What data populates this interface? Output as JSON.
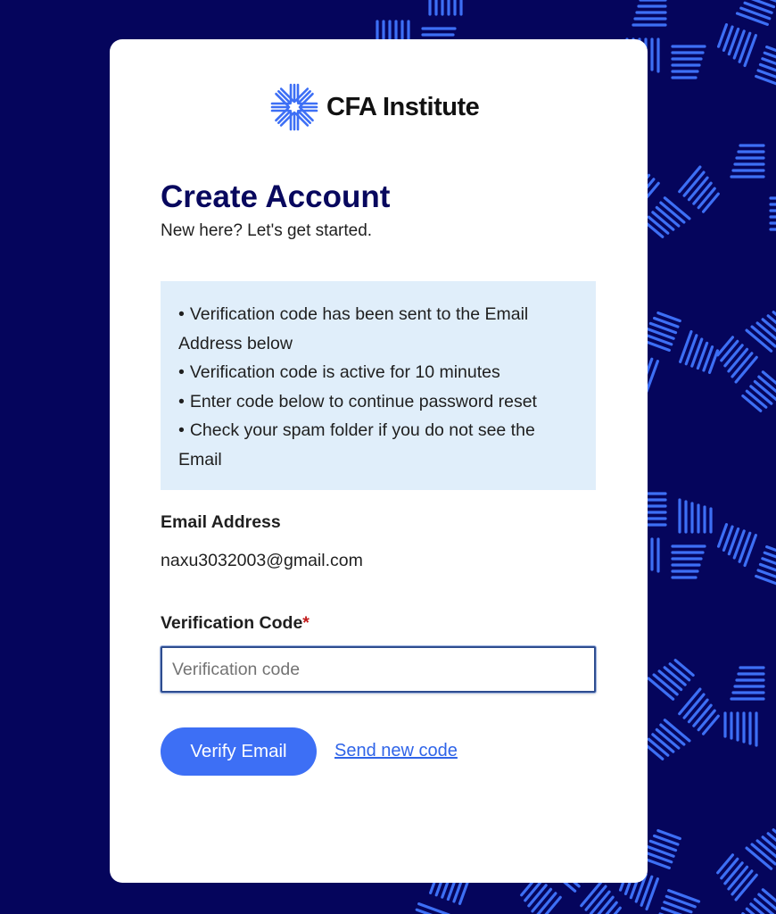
{
  "colors": {
    "background": "#05055c",
    "pattern": "#3d6ff5",
    "card": "#ffffff",
    "heading": "#08085e",
    "info_panel": "#e0eefa",
    "primary_button": "#3d6ff5",
    "link": "#2f64e8",
    "required_mark": "#c21a1a"
  },
  "brand": {
    "logo_icon": "cfa-starburst-icon",
    "name": "CFA Institute"
  },
  "header": {
    "title": "Create Account",
    "subtitle": "New here? Let's get started."
  },
  "info": {
    "items": [
      "Verification code has been sent to the Email Address below",
      "Verification code is active for 10 minutes",
      "Enter code below to continue password reset",
      "Check your spam folder if you do not see the Email"
    ]
  },
  "email": {
    "label": "Email Address",
    "value": "naxu3032003@gmail.com"
  },
  "verification": {
    "label": "Verification Code",
    "required_mark": "*",
    "placeholder": "Verification code",
    "value": ""
  },
  "actions": {
    "verify_label": "Verify Email",
    "resend_label": "Send new code"
  }
}
